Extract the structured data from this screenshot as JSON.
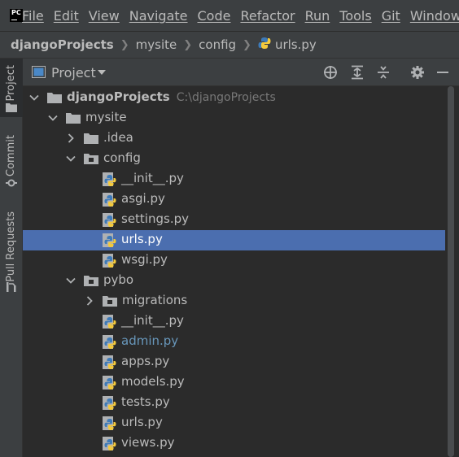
{
  "menubar": {
    "items": [
      "File",
      "Edit",
      "View",
      "Navigate",
      "Code",
      "Refactor",
      "Run",
      "Tools",
      "Git",
      "Window"
    ],
    "logo": "PC"
  },
  "breadcrumb": {
    "items": [
      "djangoProjects",
      "mysite",
      "config",
      "urls.py"
    ]
  },
  "tool_stripe": {
    "project": "Project",
    "commit": "Commit",
    "pull_requests": "Pull Requests"
  },
  "panel": {
    "title": "Project",
    "icons": [
      "locate-icon",
      "expand-all-icon",
      "collapse-all-icon",
      "gear-icon",
      "minimize-icon"
    ]
  },
  "tree": {
    "root": {
      "label": "djangoProjects",
      "path": "C:\\djangoProjects"
    },
    "mysite": "mysite",
    "idea": ".idea",
    "config": "config",
    "config_files": [
      "__init__.py",
      "asgi.py",
      "settings.py",
      "urls.py",
      "wsgi.py"
    ],
    "pybo": "pybo",
    "migrations": "migrations",
    "pybo_files": [
      "__init__.py",
      "admin.py",
      "apps.py",
      "models.py",
      "tests.py",
      "urls.py",
      "views.py"
    ]
  },
  "colors": {
    "background": "#2b2b2b",
    "chrome": "#3c3f41",
    "selection": "#4b6eaf",
    "modified_file": "#6897bb"
  }
}
